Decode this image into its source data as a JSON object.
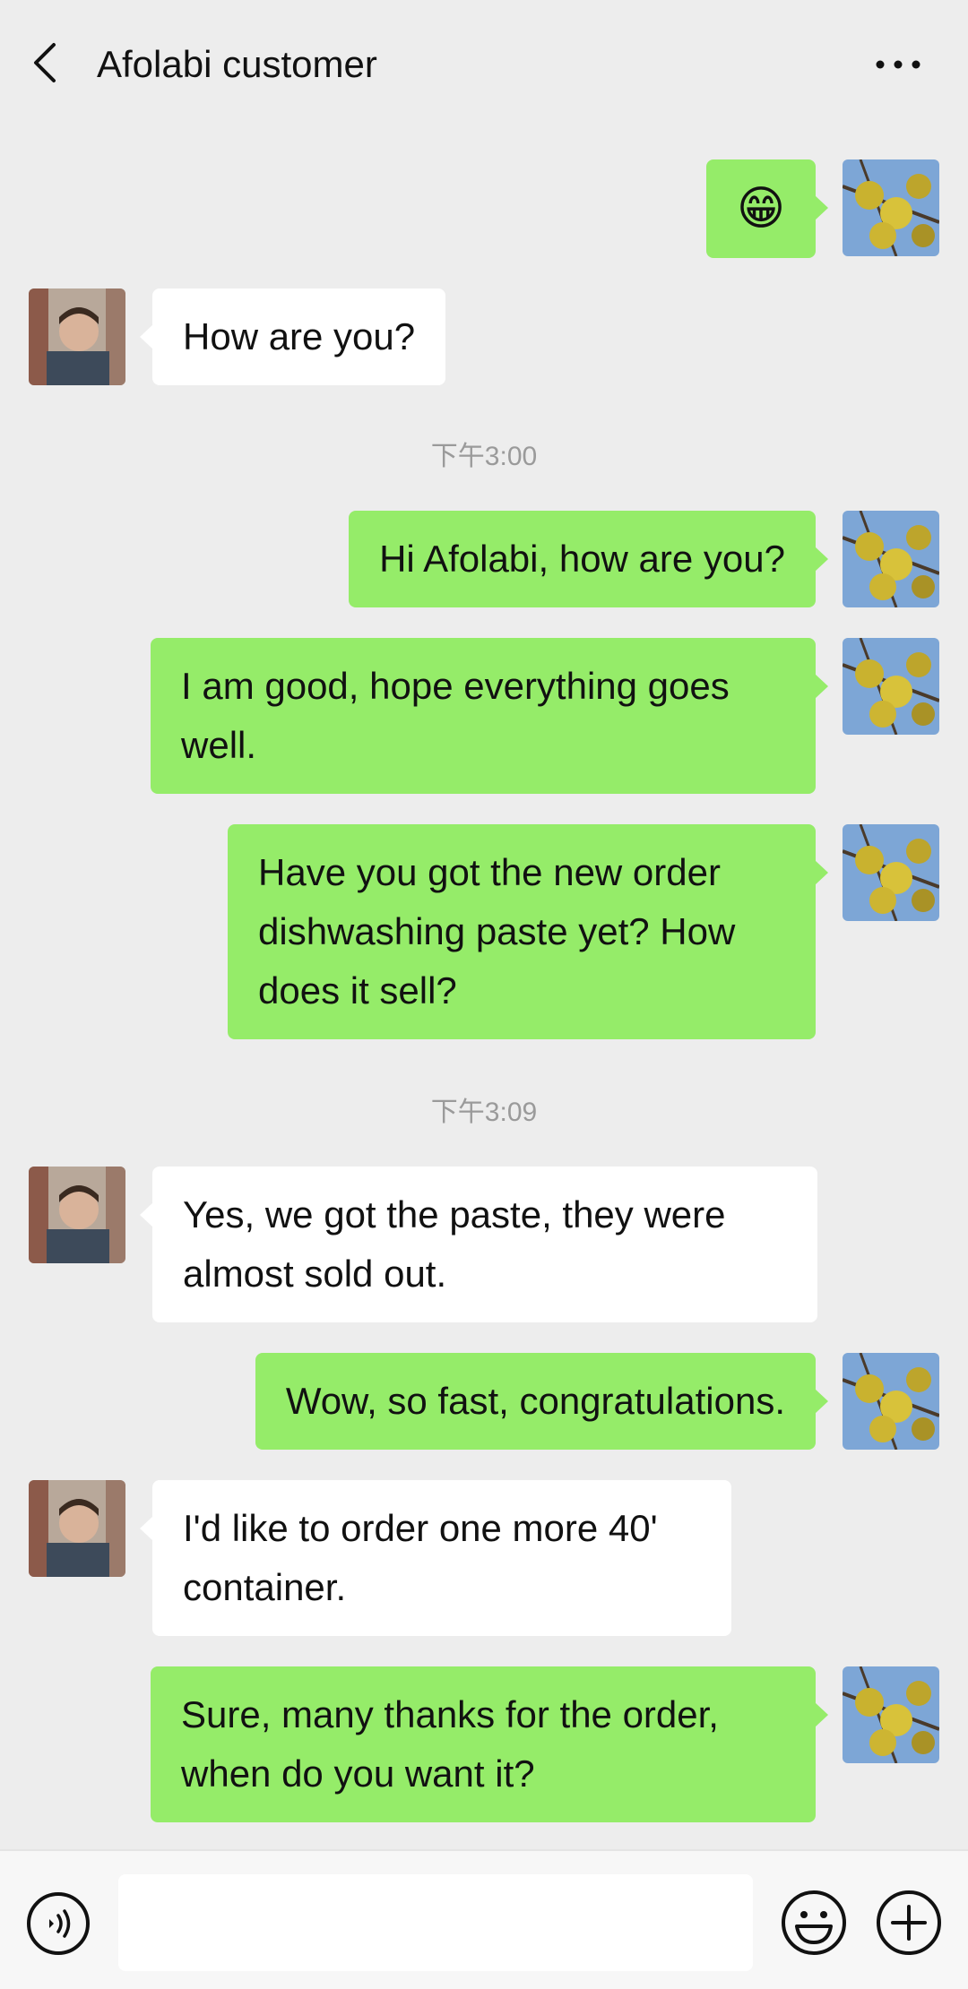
{
  "header": {
    "title": "Afolabi customer",
    "back_icon": "chevron-left-icon",
    "more_icon": "more-dots-icon"
  },
  "messages": [
    {
      "from": "me",
      "text": "😁"
    },
    {
      "from": "them",
      "text": "How are you?"
    },
    {
      "type": "time",
      "text": "下午3:00"
    },
    {
      "from": "me",
      "text": "Hi Afolabi, how are you?"
    },
    {
      "from": "me",
      "text": "I am good, hope everything goes well."
    },
    {
      "from": "me",
      "text": "Have you got the new order dishwashing paste yet? How does it sell?"
    },
    {
      "type": "time",
      "text": "下午3:09"
    },
    {
      "from": "them",
      "text": "Yes, we got the paste, they were almost sold out."
    },
    {
      "from": "me",
      "text": "Wow, so fast, congratulations."
    },
    {
      "from": "them",
      "text": "I'd like to order one more 40' container."
    },
    {
      "from": "me",
      "text": "Sure, many thanks for the order, when do you want it?"
    }
  ],
  "bottom_bar": {
    "voice_icon": "voice-icon",
    "input_value": "",
    "emoji_icon": "emoji-icon",
    "plus_icon": "plus-icon"
  },
  "colors": {
    "background": "#ededed",
    "my_bubble": "#95ec69",
    "their_bubble": "#ffffff",
    "timestamp": "#9a9a9a"
  }
}
